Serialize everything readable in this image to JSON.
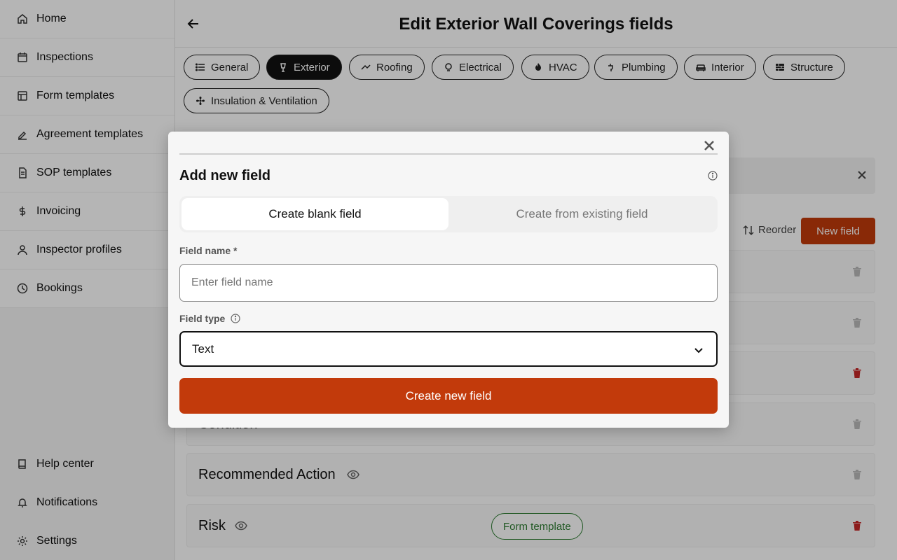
{
  "sidebar": {
    "items": [
      {
        "label": "Home",
        "icon": "home-icon"
      },
      {
        "label": "Inspections",
        "icon": "calendar-icon"
      },
      {
        "label": "Form templates",
        "icon": "layout-icon"
      },
      {
        "label": "Agreement templates",
        "icon": "signature-icon"
      },
      {
        "label": "SOP templates",
        "icon": "document-icon"
      },
      {
        "label": "Invoicing",
        "icon": "dollar-icon"
      },
      {
        "label": "Inspector profiles",
        "icon": "user-icon"
      },
      {
        "label": "Bookings",
        "icon": "clock-icon"
      }
    ],
    "bottom_items": [
      {
        "label": "Help center",
        "icon": "book-icon"
      },
      {
        "label": "Notifications",
        "icon": "bell-icon"
      },
      {
        "label": "Settings",
        "icon": "gear-icon"
      }
    ]
  },
  "header": {
    "title": "Edit Exterior Wall Coverings fields"
  },
  "tabs": [
    {
      "label": "General",
      "icon": "list-icon"
    },
    {
      "label": "Exterior",
      "icon": "lamp-icon",
      "active": true
    },
    {
      "label": "Roofing",
      "icon": "roof-icon"
    },
    {
      "label": "Electrical",
      "icon": "bulb-icon"
    },
    {
      "label": "HVAC",
      "icon": "flame-icon"
    },
    {
      "label": "Plumbing",
      "icon": "faucet-icon"
    },
    {
      "label": "Interior",
      "icon": "sofa-icon"
    },
    {
      "label": "Structure",
      "icon": "brick-icon"
    },
    {
      "label": "Insulation & Ventilation",
      "icon": "fan-icon"
    }
  ],
  "toolbar": {
    "reorder_label": "Reorder",
    "new_field_label": "New field"
  },
  "fields": [
    {
      "name": ""
    },
    {
      "name": ""
    },
    {
      "name": ""
    },
    {
      "name": "Condition"
    },
    {
      "name": "Recommended Action"
    },
    {
      "name": "Risk",
      "badge": "Form template"
    }
  ],
  "modal": {
    "title": "Add new field",
    "segments": {
      "blank": "Create blank field",
      "existing": "Create from existing field"
    },
    "field_name_label": "Field name *",
    "field_name_placeholder": "Enter field name",
    "field_name_value": "",
    "field_type_label": "Field type",
    "field_type_value": "Text",
    "submit_label": "Create new field"
  },
  "colors": {
    "accent": "#c23a0b",
    "badge_green": "#2e7d32",
    "trash_red": "#c62828"
  }
}
